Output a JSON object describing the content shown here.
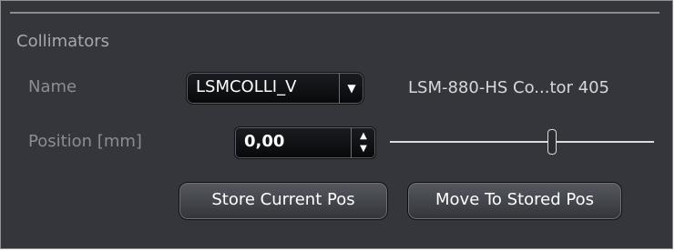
{
  "section": {
    "title": "Collimators"
  },
  "name_row": {
    "label": "Name",
    "selected": "LSMCOLLI_V",
    "value_text": "LSM-880-HS Co...tor 405"
  },
  "position_row": {
    "label": "Position [mm]",
    "value": "0,00"
  },
  "buttons": {
    "store": "Store Current Pos",
    "move": "Move To Stored Pos"
  },
  "icons": {
    "dropdown": "chevron-down-icon",
    "spin_up": "chevron-up-icon",
    "spin_down": "chevron-down-icon"
  },
  "colors": {
    "panel_bg": "#34363b",
    "text_primary": "#ffffff",
    "text_label": "#8a8d92"
  }
}
